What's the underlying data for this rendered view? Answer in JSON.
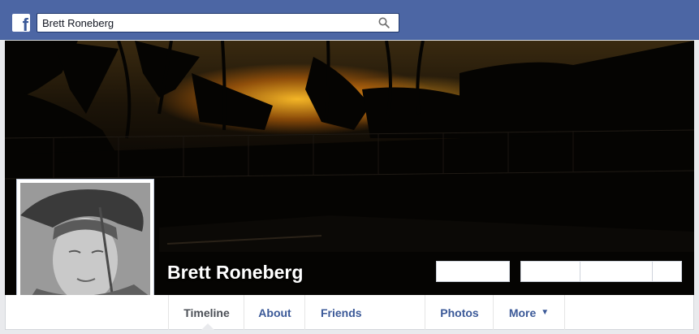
{
  "header": {
    "logo": "f",
    "search_value": "Brett Roneberg",
    "search_icon": "magnifier-icon"
  },
  "cover": {
    "description_icon": "cover-photo"
  },
  "profile": {
    "name": "Brett Roneberg"
  },
  "tabs": [
    {
      "label": "Timeline",
      "active": true
    },
    {
      "label": "About"
    },
    {
      "label": "Friends"
    },
    {
      "label": "Photos"
    },
    {
      "label": "More",
      "icon": "caret-down-icon"
    }
  ],
  "colors": {
    "brand_blue": "#4c66a4",
    "link_blue": "#3b5998",
    "page_bg": "#e9eaed"
  }
}
